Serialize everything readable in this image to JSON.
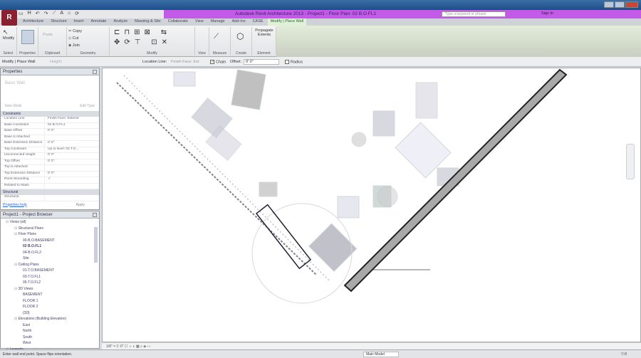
{
  "window": {
    "title": "Autodesk Revit Architecture 2013 - Project1 - Floor Plan: 02 B.O.FL1",
    "app_button": "R"
  },
  "search": {
    "placeholder": "Type a keyword or phrase"
  },
  "signin": "Sign In",
  "tabs": [
    "Architecture",
    "Structure",
    "Insert",
    "Annotate",
    "Analyze",
    "Massing & Site",
    "Collaborate",
    "View",
    "Manage",
    "Add-Ins",
    "CASE",
    "Modify | Place Wall"
  ],
  "ribbon": {
    "panels": [
      "Select",
      "Properties",
      "Clipboard",
      "Geometry",
      "Modify",
      "View",
      "Measure",
      "Create",
      "Element"
    ],
    "buttons": {
      "modify": "Modify",
      "properties": "Properties",
      "copy": "Copy",
      "cut": "Cut",
      "join": "Join",
      "paste": "Paste",
      "propagate": "Propagate Extents"
    }
  },
  "options": {
    "context": "Modify | Place Wall",
    "height_label": "Height:",
    "location_line_label": "Location Line:",
    "location_line_value": "Finish Face: Ext",
    "chain": "Chain",
    "offset_label": "Offset:",
    "offset_value": "0' 0\"",
    "radius": "Radius"
  },
  "properties": {
    "title": "Properties",
    "type_selector": "Basic Wall",
    "new_label": "New Walls",
    "edit_type": "Edit Type",
    "groups": {
      "constraints": "Constraints",
      "structural": "Structural"
    },
    "rows": [
      {
        "name": "Location Line",
        "value": "Finish Face: Exterior"
      },
      {
        "name": "Base Constraint",
        "value": "02 B.O.FL1"
      },
      {
        "name": "Base Offset",
        "value": "0' 0\""
      },
      {
        "name": "Base is Attached",
        "value": ""
      },
      {
        "name": "Base Extension Distance",
        "value": "0' 0\""
      },
      {
        "name": "Top Constraint",
        "value": "Up to level: 03 T.O..."
      },
      {
        "name": "Unconnected Height",
        "value": "0' 0\""
      },
      {
        "name": "Top Offset",
        "value": "0' 0\""
      },
      {
        "name": "Top is Attached",
        "value": ""
      },
      {
        "name": "Top Extension Distance",
        "value": "0' 0\""
      },
      {
        "name": "Room Bounding",
        "value": "✓"
      },
      {
        "name": "Related to Mass",
        "value": ""
      }
    ],
    "structural_row": "Structural",
    "help_link": "Properties help",
    "apply": "Apply"
  },
  "browser": {
    "title": "Project1 - Project Browser",
    "items": [
      {
        "label": "Views (all)",
        "level": 0
      },
      {
        "label": "Structural Plans",
        "level": 1
      },
      {
        "label": "Floor Plans",
        "level": 1
      },
      {
        "label": "00-B.O.BASEMENT",
        "level": 2
      },
      {
        "label": "02 B.O.FL1",
        "level": 2,
        "bold": true
      },
      {
        "label": "04-B.O.FL2",
        "level": 2
      },
      {
        "label": "Site",
        "level": 2
      },
      {
        "label": "Ceiling Plans",
        "level": 1
      },
      {
        "label": "01-T.O.BASEMENT",
        "level": 2
      },
      {
        "label": "03-T.O.FL1",
        "level": 2
      },
      {
        "label": "05-T.O.FL2",
        "level": 2
      },
      {
        "label": "3D Views",
        "level": 1
      },
      {
        "label": "BASEMENT",
        "level": 2
      },
      {
        "label": "FLOOR 1",
        "level": 2
      },
      {
        "label": "FLOOR 2",
        "level": 2
      },
      {
        "label": "{3D}",
        "level": 2
      },
      {
        "label": "Elevations (Building Elevation)",
        "level": 1
      },
      {
        "label": "East",
        "level": 2
      },
      {
        "label": "North",
        "level": 2
      },
      {
        "label": "South",
        "level": 2
      },
      {
        "label": "West",
        "level": 2
      },
      {
        "label": "Legends",
        "level": 0
      }
    ]
  },
  "viewbar": {
    "scale": "1/8\" = 1'-0\""
  },
  "status": {
    "text": "Enter wall end point.  Space flips orientation.",
    "model": "Main Model",
    "filter": ":0"
  }
}
